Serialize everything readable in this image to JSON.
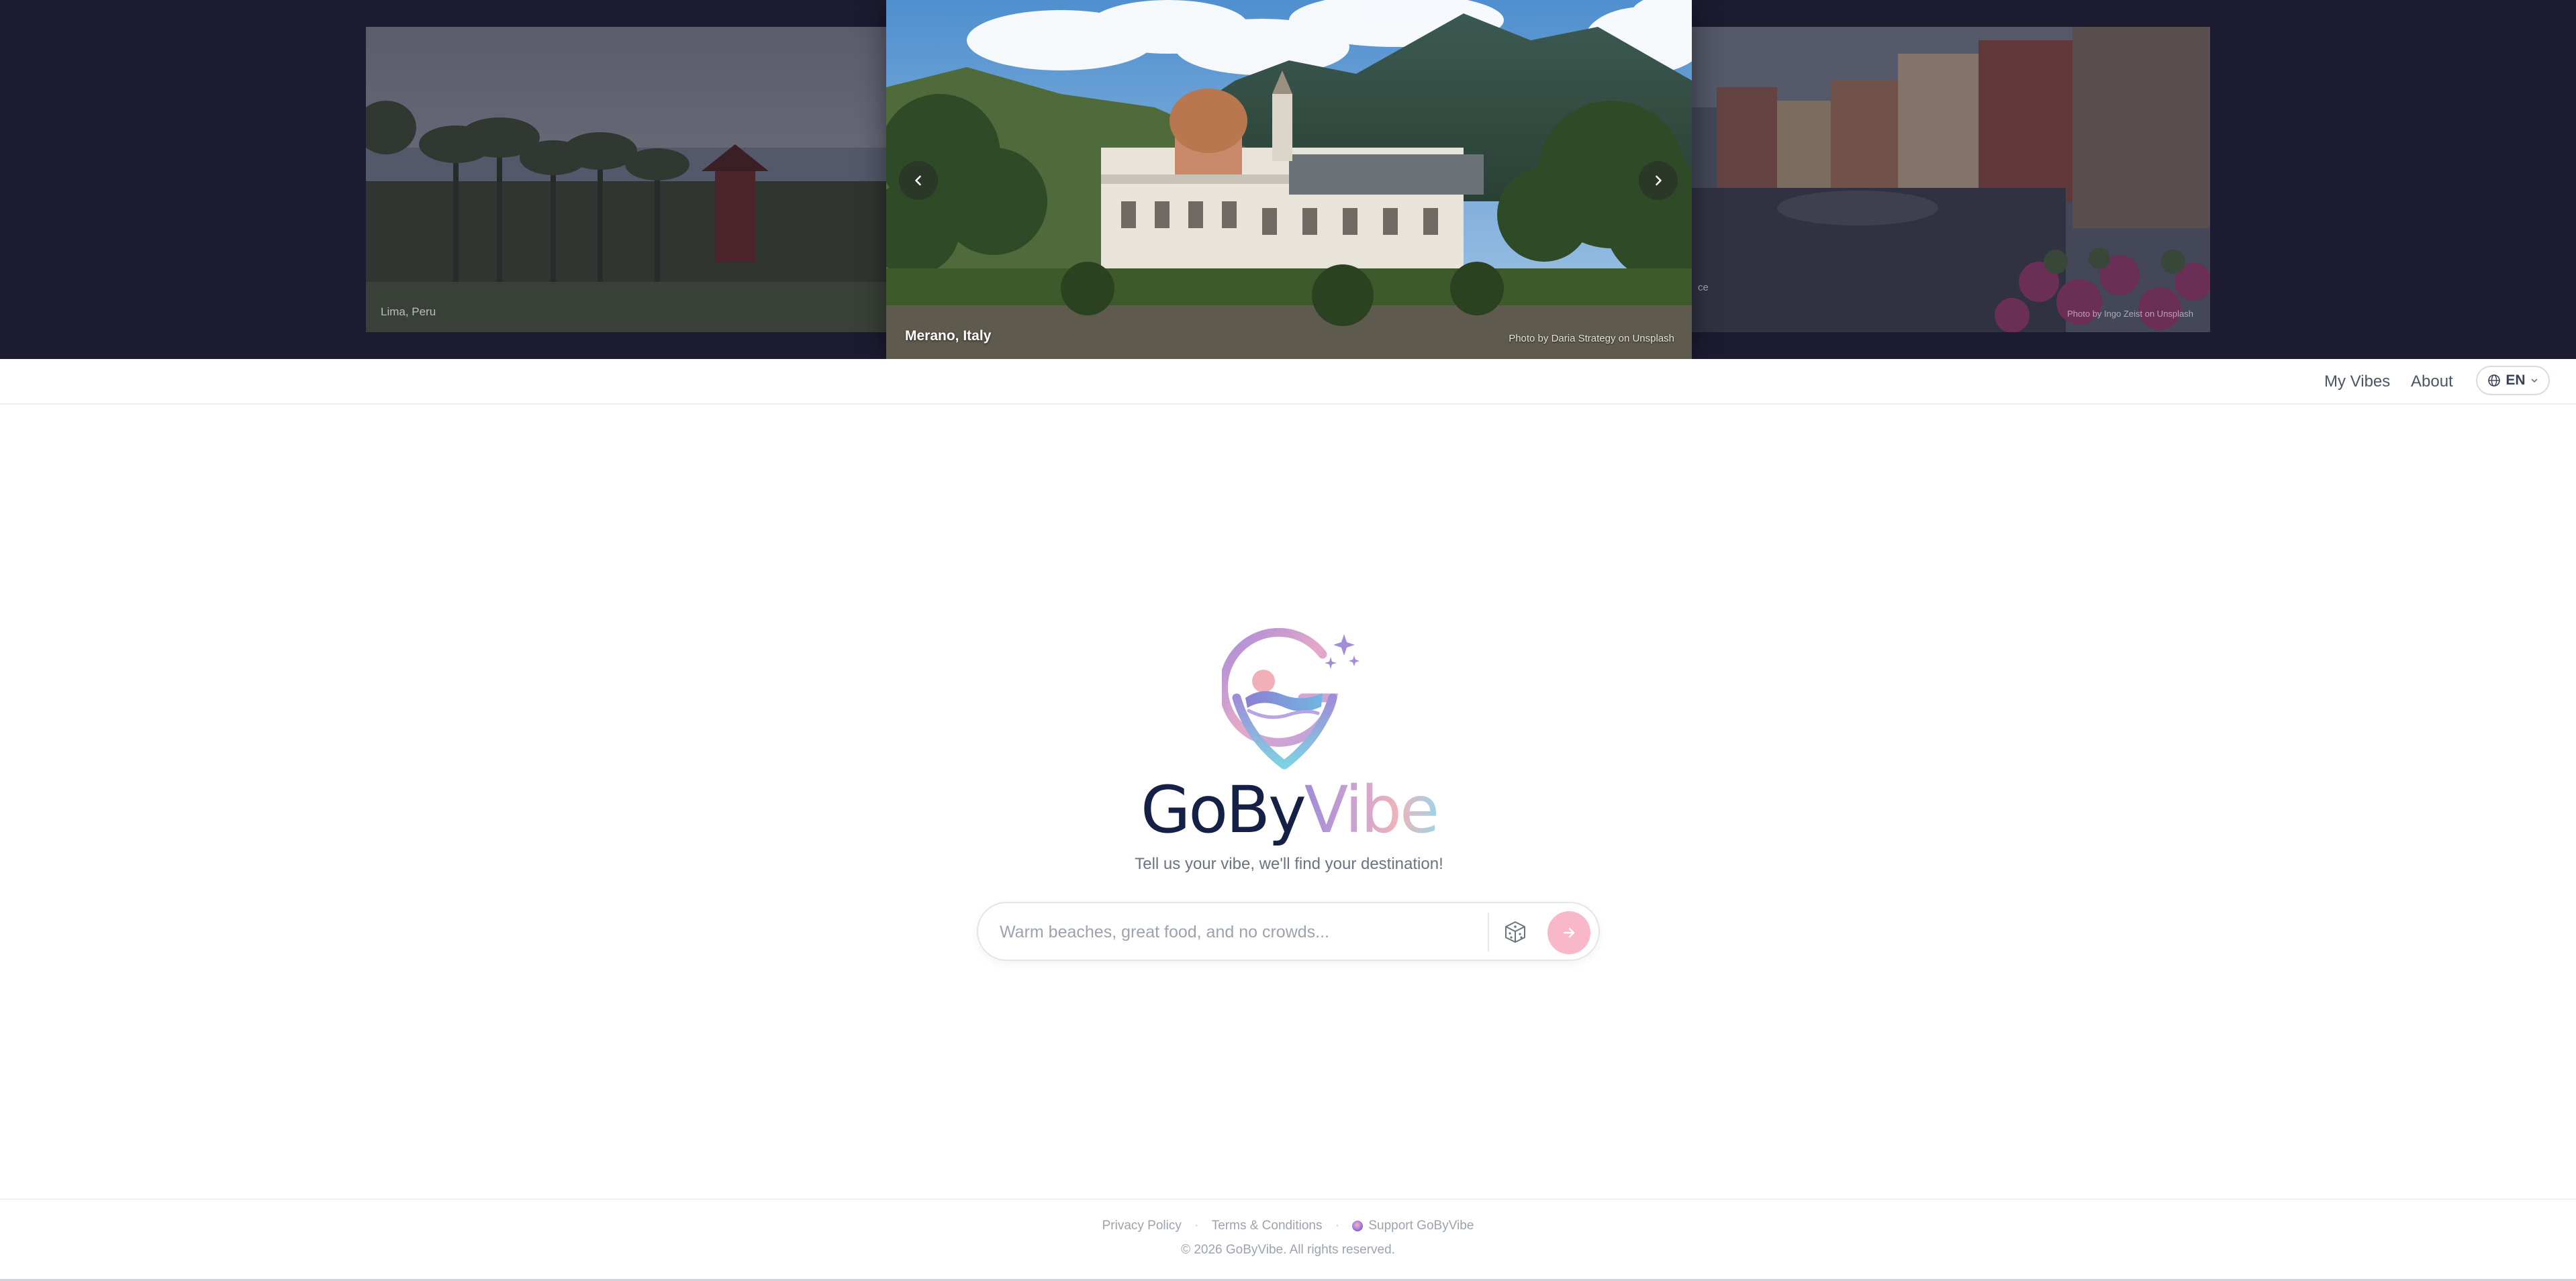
{
  "carousel": {
    "left_slide": {
      "city": "Lima, Peru"
    },
    "center_slide": {
      "city": "Merano, Italy",
      "credit": "Photo by Daria Strategy on Unsplash"
    },
    "right_slide": {
      "partial": "ce",
      "credit": "Photo by Ingo Zeist on Unsplash"
    },
    "prev_glyph": "‹",
    "next_glyph": "›"
  },
  "nav": {
    "my_vibes": "My Vibes",
    "about": "About",
    "language": "EN"
  },
  "brand": {
    "name_part1": "GoBy",
    "name_part2": "Vibe",
    "tagline": "Tell us your vibe, we'll find your destination!"
  },
  "search": {
    "placeholder": "Warm beaches, great food, and no crowds...",
    "value": ""
  },
  "footer": {
    "privacy": "Privacy Policy",
    "separator": "·",
    "terms": "Terms & Conditions",
    "support": "Support GoByVibe",
    "copyright": "© 2026 GoByVibe. All rights reserved."
  },
  "colors": {
    "carousel_bg": "#1c1b31",
    "brand_navy": "#142045",
    "accent_pink": "#f8b8c9",
    "accent_purple": "#a08cd8",
    "accent_cyan": "#9dd3e8"
  },
  "icons": {
    "prev": "chevron-left-icon",
    "next": "chevron-right-icon",
    "language": "globe-icon",
    "dropdown": "chevron-down-icon",
    "random": "dice-icon",
    "submit": "arrow-right-icon"
  }
}
